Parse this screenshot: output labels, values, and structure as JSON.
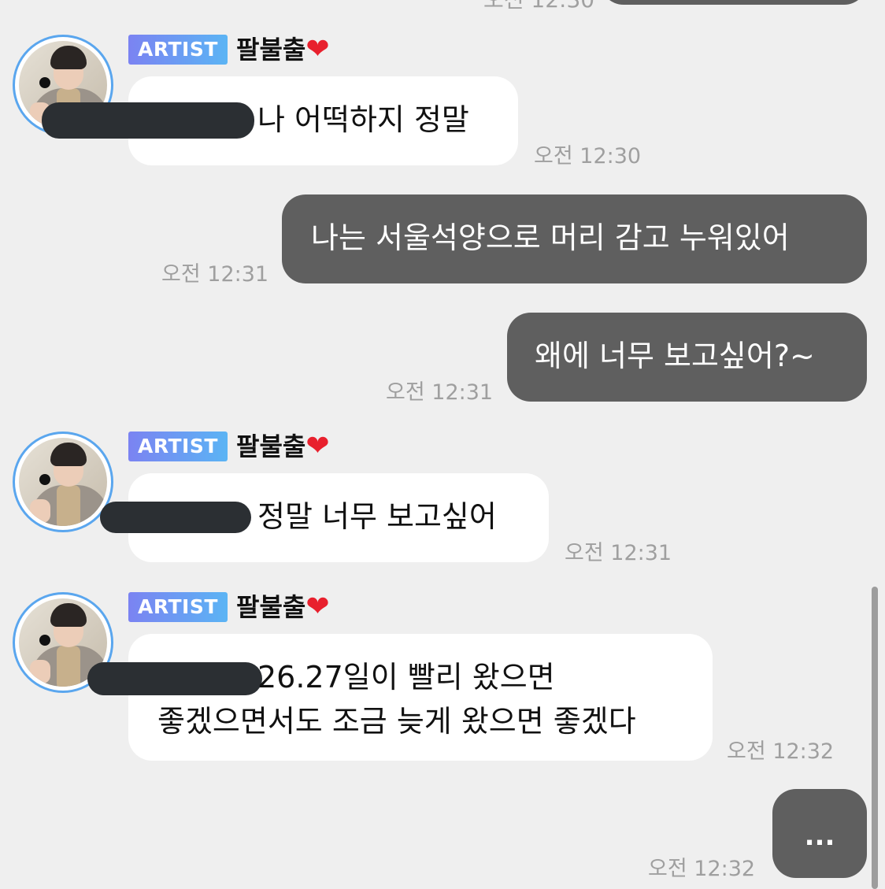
{
  "top_message": {
    "time": "오전 12:30"
  },
  "messages": [
    {
      "sender": {
        "badge": "ARTIST",
        "name": "팔불출",
        "heart": "❤"
      },
      "text": "나 어떡하지 정말",
      "time": "오전 12:30"
    },
    {
      "text": "나는 서울석양으로 머리 감고 누워있어",
      "time": "오전 12:31"
    },
    {
      "text": "왜에 너무 보고싶어?~",
      "time": "오전 12:31"
    },
    {
      "sender": {
        "badge": "ARTIST",
        "name": "팔불출",
        "heart": "❤"
      },
      "text": "정말 너무 보고싶어",
      "time": "오전 12:31"
    },
    {
      "sender": {
        "badge": "ARTIST",
        "name": "팔불출",
        "heart": "❤"
      },
      "line1": "26.27일이 빨리 왔으면",
      "line2": "좋겠으면서도 조금 늦게 왔으면 좋겠다",
      "time": "오전 12:32"
    },
    {
      "text": "...",
      "time": "오전 12:32"
    }
  ]
}
